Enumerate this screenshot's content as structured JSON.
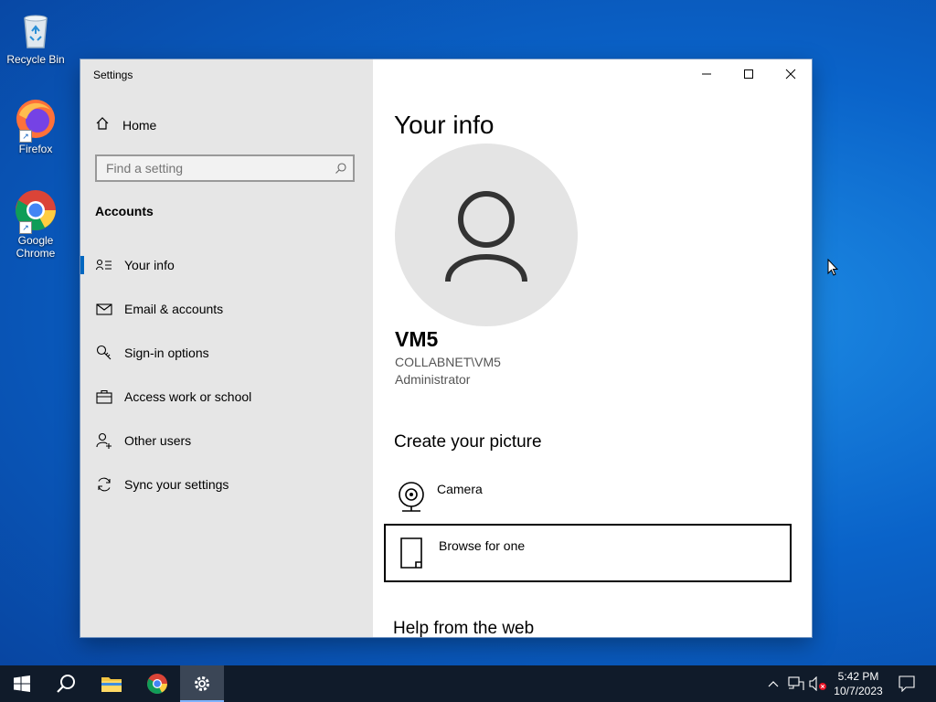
{
  "desktop": {
    "icons": [
      {
        "label": "Recycle Bin"
      },
      {
        "label": "Firefox"
      },
      {
        "label": "Google Chrome"
      }
    ]
  },
  "window": {
    "title": "Settings",
    "controls": {
      "minimize": "minimize-icon",
      "maximize": "maximize-icon",
      "close": "close-icon"
    }
  },
  "sidebar": {
    "home_label": "Home",
    "search_placeholder": "Find a setting",
    "section_title": "Accounts",
    "items": [
      {
        "label": "Your info",
        "icon": "contact-card-icon",
        "selected": true
      },
      {
        "label": "Email & accounts",
        "icon": "mail-icon"
      },
      {
        "label": "Sign-in options",
        "icon": "key-icon"
      },
      {
        "label": "Access work or school",
        "icon": "briefcase-icon"
      },
      {
        "label": "Other users",
        "icon": "add-user-icon"
      },
      {
        "label": "Sync your settings",
        "icon": "sync-icon"
      }
    ]
  },
  "main": {
    "title": "Your info",
    "user": {
      "name": "VM5",
      "account": "COLLABNET\\VM5",
      "role": "Administrator"
    },
    "picture_heading": "Create your picture",
    "options": [
      {
        "label": "Camera",
        "icon": "camera-icon"
      },
      {
        "label": "Browse for one",
        "icon": "file-icon",
        "focused": true
      }
    ],
    "help_heading": "Help from the web"
  },
  "taskbar": {
    "items": [
      "start",
      "search",
      "file-explorer",
      "google-chrome",
      "settings"
    ],
    "active": "settings",
    "clock": {
      "time": "5:42 PM",
      "date": "10/7/2023"
    }
  },
  "colors": {
    "accent": "#0067c0",
    "sidebar_bg": "#e6e6e6",
    "taskbar_bg": "#101b2a"
  }
}
